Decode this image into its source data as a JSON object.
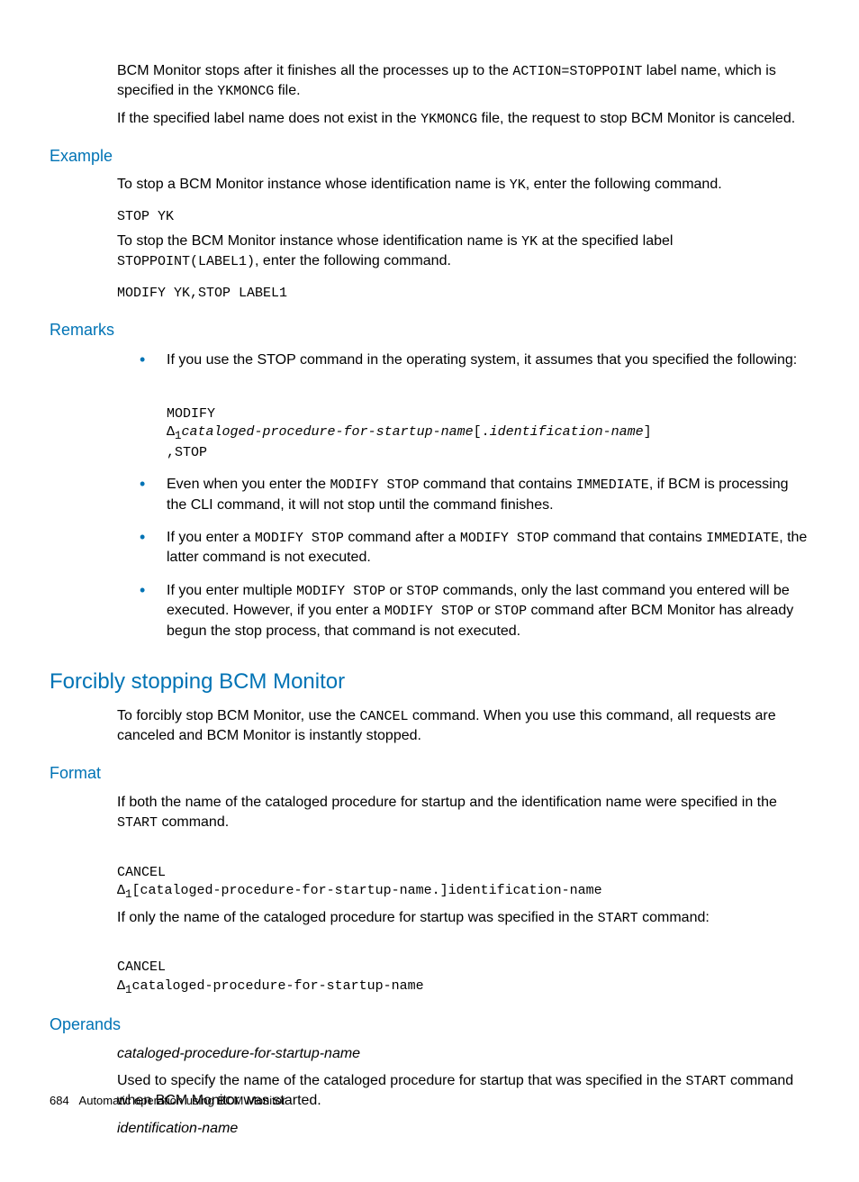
{
  "intro": {
    "p1a": "BCM Monitor stops after it finishes all the processes up to the ",
    "p1code1": "ACTION=STOPPOINT",
    "p1b": " label name, which is specified in the ",
    "p1code2": "YKMONCG",
    "p1c": " file.",
    "p2a": "If the specified label name does not exist in the ",
    "p2code1": "YKMONCG",
    "p2b": " file, the request to stop BCM Monitor is canceled."
  },
  "example": {
    "heading": "Example",
    "p1a": "To stop a BCM Monitor instance whose identification name is ",
    "p1code": "YK",
    "p1b": ", enter the following command.",
    "code1": "STOP YK",
    "p2a": "To stop the BCM Monitor instance whose identification name is ",
    "p2code1": "YK",
    "p2b": " at the specified label ",
    "p2code2": "STOPPOINT(LABEL1)",
    "p2c": ", enter the following command.",
    "code2": "MODIFY YK,STOP LABEL1"
  },
  "remarks": {
    "heading": "Remarks",
    "b1": "If you use the STOP command in the operating system, it assumes that you specified the following:",
    "b1code_l1": "MODIFY",
    "b1code_l2a": "Δ",
    "b1code_l2sub": "1",
    "b1code_l2b": "cataloged-procedure-for-startup-name",
    "b1code_l2c": "[.",
    "b1code_l2d": "identification-name",
    "b1code_l2e": "]",
    "b1code_l3": ",STOP",
    "b2a": "Even when you enter the ",
    "b2code1": "MODIFY STOP",
    "b2b": " command that contains ",
    "b2code2": "IMMEDIATE",
    "b2c": ", if BCM is processing the CLI command, it will not stop until the command finishes.",
    "b3a": "If you enter a ",
    "b3code1": "MODIFY STOP",
    "b3b": " command after a ",
    "b3code2": "MODIFY STOP",
    "b3c": " command that contains ",
    "b3code3": "IMMEDIATE",
    "b3d": ", the latter command is not executed.",
    "b4a": "If you enter multiple ",
    "b4code1": "MODIFY STOP",
    "b4b": " or ",
    "b4code2": "STOP",
    "b4c": " commands, only the last command you entered will be executed. However, if you enter a ",
    "b4code3": "MODIFY STOP",
    "b4d": " or ",
    "b4code4": "STOP",
    "b4e": " command after BCM Monitor has already begun the stop process, that command is not executed."
  },
  "forcibly": {
    "heading": "Forcibly stopping BCM Monitor",
    "p1a": "To forcibly stop BCM Monitor, use the ",
    "p1code": "CANCEL",
    "p1b": " command. When you use this command, all requests are canceled and BCM Monitor is instantly stopped."
  },
  "format": {
    "heading": "Format",
    "p1a": "If both the name of the cataloged procedure for startup and the identification name were specified in the ",
    "p1code": "START",
    "p1b": " command.",
    "code1_l1": "CANCEL",
    "code1_l2a": "Δ",
    "code1_l2sub": "1",
    "code1_l2b": "[cataloged-procedure-for-startup-name.]identification-name",
    "p2a": "If only the name of the cataloged procedure for startup was specified in the ",
    "p2code": "START",
    "p2b": " command:",
    "code2_l1": "CANCEL",
    "code2_l2a": "Δ",
    "code2_l2sub": "1",
    "code2_l2b": "cataloged-procedure-for-startup-name"
  },
  "operands": {
    "heading": "Operands",
    "term1": "cataloged-procedure-for-startup-name",
    "desc1a": "Used to specify the name of the cataloged procedure for startup that was specified in the ",
    "desc1code": "START",
    "desc1b": " command when BCM Monitor was started.",
    "term2": "identification-name"
  },
  "footer": {
    "page": "684",
    "text": "Automatic operation using BCM Monitor"
  }
}
